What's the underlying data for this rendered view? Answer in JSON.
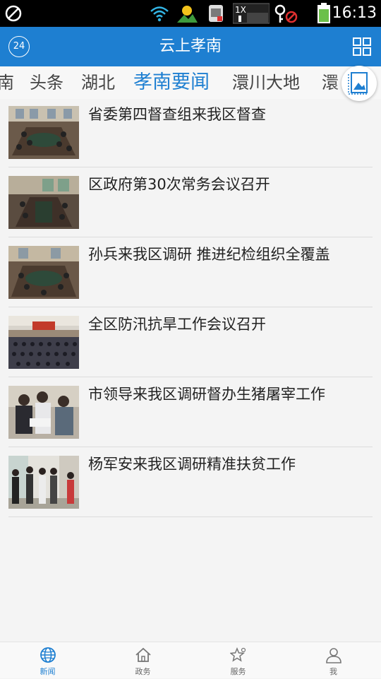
{
  "status_bar": {
    "time": "16:13",
    "sim_label": "1X",
    "icons": [
      "blocked-icon",
      "wifi-icon",
      "weather-icon",
      "screenshot-icon",
      "signal-icon",
      "key-icon",
      "battery-icon"
    ]
  },
  "app_bar": {
    "title": "云上孝南",
    "badge": "24",
    "left_icon": "badge-icon",
    "right_icon": "grid-icon",
    "color": "#1e7fd1"
  },
  "tabs": [
    {
      "label": "南",
      "active": false
    },
    {
      "label": "头条",
      "active": false
    },
    {
      "label": "湖北",
      "active": false
    },
    {
      "label": "孝南要闻",
      "active": true
    },
    {
      "label": "澴川大地",
      "active": false
    },
    {
      "label": "澴",
      "active": false
    }
  ],
  "news": [
    {
      "title": "省委第四督查组来我区督查",
      "thumb": "meeting-photo"
    },
    {
      "title": "区政府第30次常务会议召开",
      "thumb": "meeting-photo"
    },
    {
      "title": "孙兵来我区调研 推进纪检组织全覆盖",
      "thumb": "meeting-photo"
    },
    {
      "title": "全区防汛抗旱工作会议召开",
      "thumb": "conference-hall-photo"
    },
    {
      "title": "市领导来我区调研督办生猪屠宰工作",
      "thumb": "inspection-photo"
    },
    {
      "title": "杨军安来我区调研精准扶贫工作",
      "thumb": "visit-photo"
    }
  ],
  "bottom_nav": [
    {
      "label": "新闻",
      "icon": "globe-icon",
      "active": true
    },
    {
      "label": "政务",
      "icon": "home-icon",
      "active": false
    },
    {
      "label": "服务",
      "icon": "star-icon",
      "active": false
    },
    {
      "label": "我",
      "icon": "user-icon",
      "active": false
    }
  ]
}
